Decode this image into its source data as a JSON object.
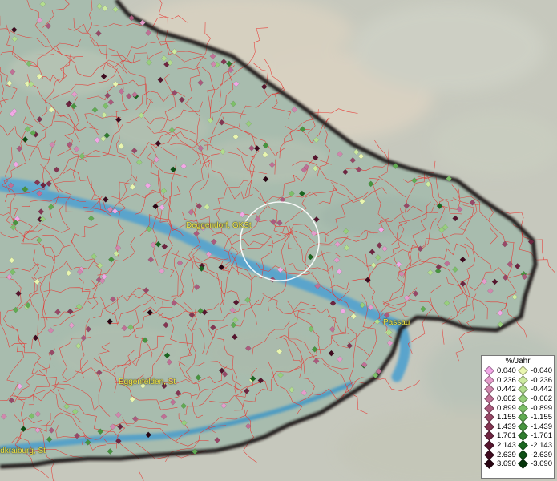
{
  "labels": {
    "deggendorf": "Deggendorf, GKSt",
    "passau": "Passau",
    "eggenfelden": "Eggenfelden, St",
    "muehldorf": "ldkraiburg, St"
  },
  "legend": {
    "title": "%/Jahr",
    "positive": [
      {
        "value": "0.040",
        "color": "#f2a8e6"
      },
      {
        "value": "0.236",
        "color": "#e59ccb"
      },
      {
        "value": "0.442",
        "color": "#d187ae"
      },
      {
        "value": "0.662",
        "color": "#c07096"
      },
      {
        "value": "0.899",
        "color": "#ab5a7d"
      },
      {
        "value": "1.155",
        "color": "#984867"
      },
      {
        "value": "1.439",
        "color": "#843552"
      },
      {
        "value": "1.761",
        "color": "#6e2440"
      },
      {
        "value": "2.143",
        "color": "#56152e"
      },
      {
        "value": "2.639",
        "color": "#3f0a1f"
      },
      {
        "value": "3.690",
        "color": "#290412"
      }
    ],
    "negative": [
      {
        "value": "-0.040",
        "color": "#e9f6b0"
      },
      {
        "value": "-0.236",
        "color": "#cdeaa0"
      },
      {
        "value": "-0.442",
        "color": "#b3dd8e"
      },
      {
        "value": "-0.662",
        "color": "#98cf7c"
      },
      {
        "value": "-0.899",
        "color": "#7dbf69"
      },
      {
        "value": "-1.155",
        "color": "#60ab52"
      },
      {
        "value": "-1.439",
        "color": "#47943f"
      },
      {
        "value": "-1.761",
        "color": "#2f7c2e"
      },
      {
        "value": "-2.143",
        "color": "#1a6620"
      },
      {
        "value": "-2.639",
        "color": "#0d4f14"
      },
      {
        "value": "-3.690",
        "color": "#05350a"
      }
    ]
  },
  "colors": {
    "boundary": "#e8342f",
    "river": "#4f9ac4",
    "border": "#1a1212",
    "background": "#c8c8bb",
    "inside": "#a7bcad"
  }
}
